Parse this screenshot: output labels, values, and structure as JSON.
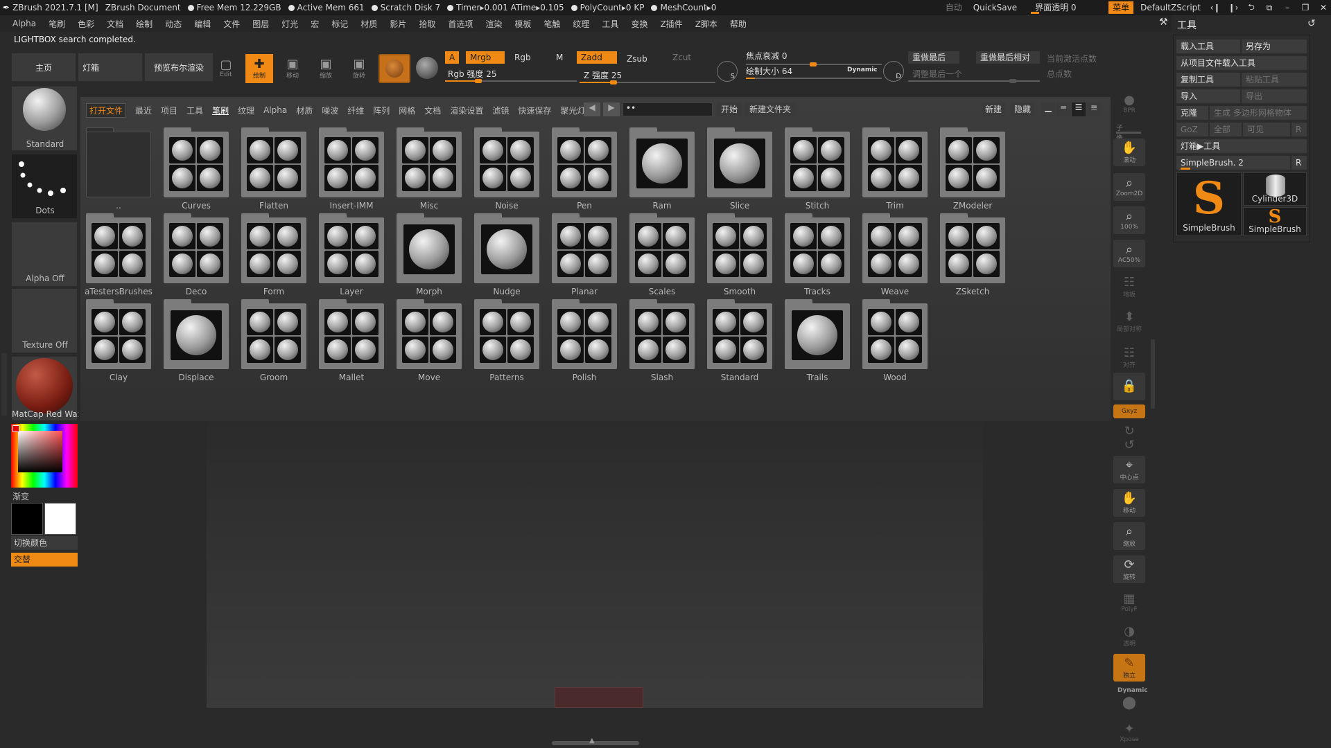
{
  "titlebar": {
    "app": "ZBrush 2021.7.1 [M]",
    "document": "ZBrush Document",
    "free_mem": "Free Mem 12.229GB",
    "active_mem": "Active Mem 661",
    "scratch_disk": "Scratch Disk 7",
    "timer": "Timer▸0.001 ATime▸0.105",
    "polycount": "PolyCount▸0 KP",
    "meshcount": "MeshCount▸0",
    "auto": "自动",
    "quicksave": "QuickSave",
    "ui_transparency": "界面透明 0",
    "menus": "菜单",
    "script": "DefaultZScript"
  },
  "menubar": [
    "Alpha",
    "笔刷",
    "色彩",
    "文档",
    "绘制",
    "动态",
    "编辑",
    "文件",
    "图层",
    "灯光",
    "宏",
    "标记",
    "材质",
    "影片",
    "拾取",
    "首选项",
    "渲染",
    "模板",
    "笔触",
    "纹理",
    "工具",
    "变换",
    "Z插件",
    "Z脚本",
    "帮助"
  ],
  "status": "LIGHTBOX search completed.",
  "toolbar": {
    "home": "主页",
    "lightbox": "灯箱",
    "preview": "预览布尔渲染",
    "edit": "Edit",
    "draw": "绘制",
    "move": "移动",
    "scale": "缩放",
    "rotate": "旋转",
    "a": "A",
    "mrgb": "Mrgb",
    "rgb": "Rgb",
    "m": "M",
    "rgb_intensity": "Rgb 强度 25",
    "zadd": "Zadd",
    "zsub": "Zsub",
    "zcut": "Zcut",
    "z_intensity": "Z 强度 25",
    "focal_shift": "焦点衰减 0",
    "draw_size": "绘制大小 64",
    "dynamic": "Dynamic",
    "s_label": "S",
    "d_label": "D",
    "redo_last": "重做最后",
    "redo_last_rel": "重做最后相对",
    "adjust_last": "调整最后一个",
    "active_points": "当前激活点数",
    "total_points": "总点数",
    "rgb_intensity_value": 25,
    "z_intensity_value": 25,
    "draw_size_value": 64
  },
  "left": {
    "brush": "Standard",
    "stroke": "Dots",
    "alpha": "Alpha Off",
    "texture": "Texture Off",
    "material": "MatCap Red Wax",
    "gradient": "渐变",
    "switch_color": "切换颜色",
    "alternate": "交替"
  },
  "lightbox": {
    "nav": [
      "打开文件",
      "最近",
      "项目",
      "工具",
      "笔刷",
      "纹理",
      "Alpha",
      "材质",
      "噪波",
      "纤维",
      "阵列",
      "网格",
      "文档",
      "渲染设置",
      "滤镜",
      "快速保存",
      "聚光灯"
    ],
    "search_text": "",
    "start": "开始",
    "new_folder": "新建文件夹",
    "new": "新建",
    "hide": "隐藏",
    "parent": "..",
    "folders_row1": [
      "Curves",
      "Flatten",
      "Insert-IMM",
      "Misc",
      "Noise",
      "Pen",
      "Ram",
      "Slice",
      "Stitch",
      "Trim",
      "ZModeler"
    ],
    "folders_row2": [
      "aTestersBrushes",
      "Deco",
      "Form",
      "Layer",
      "Morph",
      "Nudge",
      "Planar",
      "Scales",
      "Smooth",
      "Tracks",
      "Weave",
      "ZSketch"
    ],
    "folders_row3": [
      "Clay",
      "Displace",
      "Groom",
      "Mallet",
      "Move",
      "Patterns",
      "Polish",
      "Slash",
      "Standard",
      "Trails",
      "Wood"
    ]
  },
  "shelf": {
    "bpr": "BPR",
    "subpixel": "子像素",
    "scroll": "滚动",
    "zoom2d": "Zoom2D",
    "p100": "100%",
    "ac50": "AC50%",
    "floor": "地板",
    "local": "局部",
    "local_sym": "局部对称",
    "align": "对齐",
    "gxyz": "Gxyz",
    "center": "中心点",
    "move": "移动",
    "scale": "缩放",
    "rotate": "旋转",
    "polyf": "PolyF",
    "transp": "透明",
    "solo": "独立",
    "dynamic": "Dynamic",
    "xpose": "Xpose"
  },
  "toolpanel": {
    "title": "工具",
    "load": "载入工具",
    "save_as": "另存为",
    "load_from_project": "从项目文件载入工具",
    "copy": "复制工具",
    "paste": "粘贴工具",
    "import": "导入",
    "export": "导出",
    "clone": "克隆",
    "make_polymesh": "生成 多边形网格物体",
    "goz": "GoZ",
    "all": "全部",
    "visible": "可见",
    "r": "R",
    "lightbox_tools": "灯箱▶工具",
    "current_tool": "SimpleBrush. 2",
    "thumb1": "SimpleBrush",
    "thumb2": "Cylinder3D",
    "thumb3": "SimpleBrush"
  },
  "colors": {
    "accent": "#f08a14",
    "background": "#2a2a2a",
    "main_color": "#000000",
    "secondary_color": "#ffffff"
  }
}
